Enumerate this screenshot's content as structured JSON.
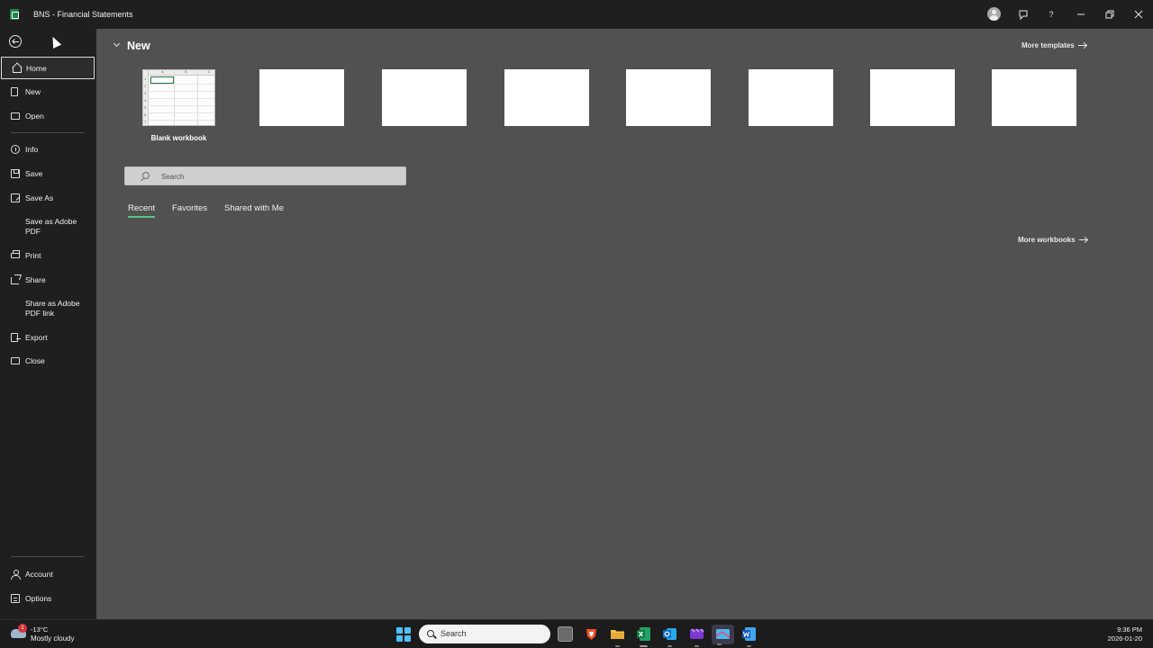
{
  "window": {
    "title": "BNS - Financial Statements"
  },
  "sidebar": {
    "items": [
      {
        "label": "Home"
      },
      {
        "label": "New"
      },
      {
        "label": "Open"
      },
      {
        "label": "Info"
      },
      {
        "label": "Save"
      },
      {
        "label": "Save As"
      },
      {
        "label": "Save as Adobe PDF"
      },
      {
        "label": "Print"
      },
      {
        "label": "Share"
      },
      {
        "label": "Share as Adobe PDF link"
      },
      {
        "label": "Export"
      },
      {
        "label": "Close"
      }
    ],
    "footer_items": [
      {
        "label": "Account"
      },
      {
        "label": "Options"
      }
    ]
  },
  "main": {
    "new_heading": "New",
    "more_templates": "More templates",
    "blank_workbook_label": "Blank workbook",
    "thumb_cols": [
      "A",
      "B",
      "C"
    ],
    "thumb_rows": [
      "1",
      "2",
      "3",
      "4",
      "5",
      "6",
      "7"
    ],
    "search_placeholder": "Search",
    "tabs": [
      {
        "label": "Recent",
        "active": true
      },
      {
        "label": "Favorites",
        "active": false
      },
      {
        "label": "Shared with Me",
        "active": false
      }
    ],
    "more_workbooks": "More workbooks"
  },
  "taskbar": {
    "weather_badge": "1",
    "weather_temp": "-13°C",
    "weather_desc": "Mostly cloudy",
    "search_label": "Search",
    "time": "9:36 PM",
    "date": "2026-01-20"
  },
  "colors": {
    "excel_green": "#1d8346",
    "selection_green": "#217346",
    "tab_underline": "#5cc28d",
    "main_bg": "#515151",
    "sidebar_bg": "#1f1f1f"
  }
}
